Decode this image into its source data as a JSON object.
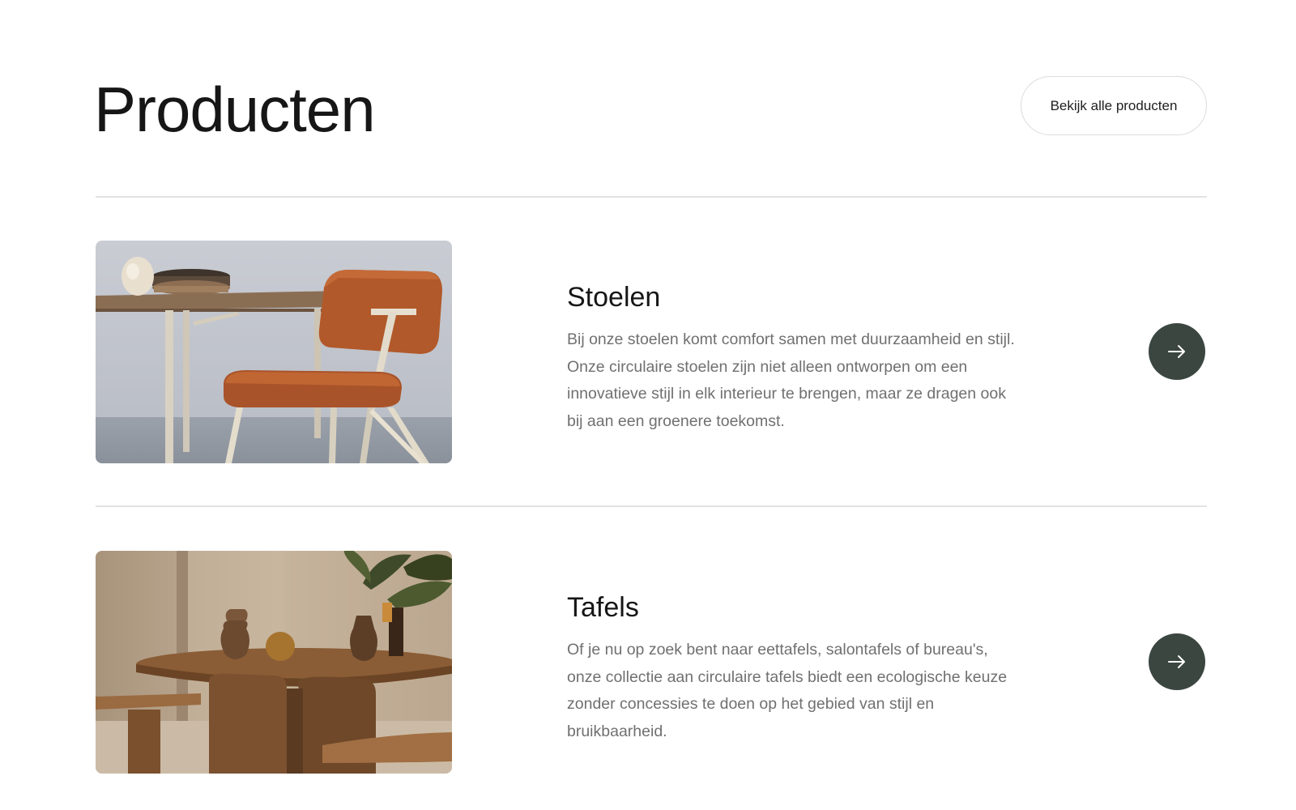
{
  "header": {
    "title": "Producten",
    "all_products_label": "Bekijk alle producten"
  },
  "products": [
    {
      "title": "Stoelen",
      "description": "Bij onze stoelen komt comfort samen met duurzaamheid en stijl. Onze circulaire stoelen zijn niet alleen ontworpen om een innovatieve stijl in elk interieur te brengen, maar ze dragen ook bij aan een groenere toekomst.",
      "image_icon": "chair-photo",
      "arrow_icon": "arrow-right-icon"
    },
    {
      "title": "Tafels",
      "description": "Of je nu op zoek bent naar eettafels, salontafels of bureau's, onze collectie aan circulaire tafels biedt een ecologische keuze zonder concessies te doen op het gebied van stijl en bruikbaarheid.",
      "image_icon": "table-photo",
      "arrow_icon": "arrow-right-icon"
    }
  ],
  "colors": {
    "arrow_button": "#3b4641",
    "divider": "#e3e3e3",
    "body_text": "#707070"
  }
}
